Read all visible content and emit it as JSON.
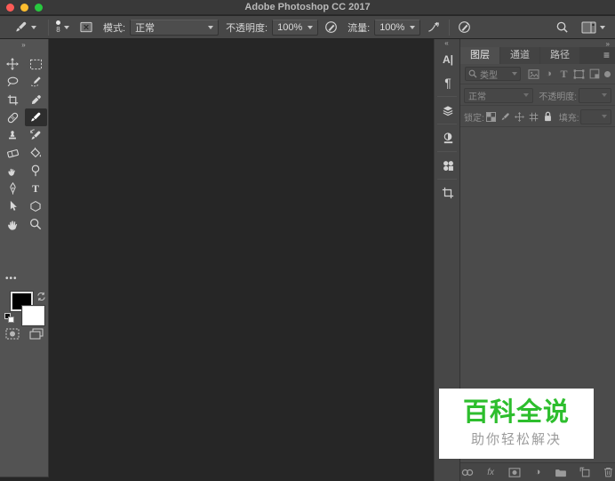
{
  "titlebar": {
    "title": "Adobe Photoshop CC 2017"
  },
  "options_bar": {
    "brush_size": "8",
    "mode_label": "模式:",
    "mode_value": "正常",
    "opacity_label": "不透明度:",
    "opacity_value": "100%",
    "flow_label": "流量:",
    "flow_value": "100%"
  },
  "layers_panel": {
    "tabs": {
      "layers": "图层",
      "channels": "通道",
      "paths": "路径"
    },
    "filter_type": "类型",
    "blend_mode": "正常",
    "opacity_label": "不透明度:",
    "lock_label": "锁定:",
    "fill_label": "填充:"
  },
  "icons": {
    "collapse_right": "»",
    "collapse_left": "«",
    "menu": "≡",
    "ellipsis": "•••",
    "character": "A|",
    "paragraph": "¶",
    "type_glyph": "T",
    "half_circle": "◑",
    "fx": "fx"
  },
  "watermark": {
    "title": "百科全说",
    "subtitle": "助你轻松解决"
  },
  "colors": {
    "accent_green": "#2dbe2d",
    "canvas": "#262626",
    "panel": "#4a4a4a",
    "toolbar": "#535353"
  }
}
